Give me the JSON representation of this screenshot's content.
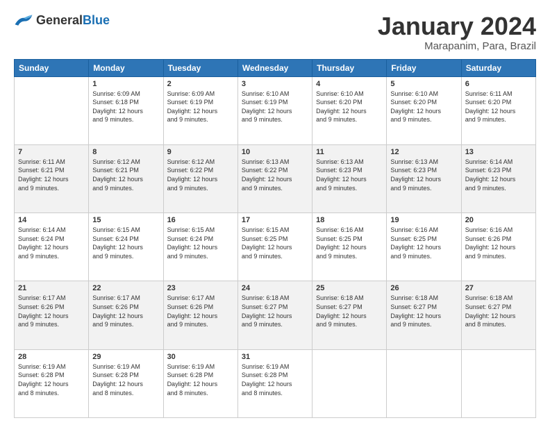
{
  "logo": {
    "general": "General",
    "blue": "Blue"
  },
  "header": {
    "title": "January 2024",
    "subtitle": "Marapanim, Para, Brazil"
  },
  "days_of_week": [
    "Sunday",
    "Monday",
    "Tuesday",
    "Wednesday",
    "Thursday",
    "Friday",
    "Saturday"
  ],
  "weeks": [
    [
      {
        "day": "",
        "info": ""
      },
      {
        "day": "1",
        "info": "Sunrise: 6:09 AM\nSunset: 6:18 PM\nDaylight: 12 hours\nand 9 minutes."
      },
      {
        "day": "2",
        "info": "Sunrise: 6:09 AM\nSunset: 6:19 PM\nDaylight: 12 hours\nand 9 minutes."
      },
      {
        "day": "3",
        "info": "Sunrise: 6:10 AM\nSunset: 6:19 PM\nDaylight: 12 hours\nand 9 minutes."
      },
      {
        "day": "4",
        "info": "Sunrise: 6:10 AM\nSunset: 6:20 PM\nDaylight: 12 hours\nand 9 minutes."
      },
      {
        "day": "5",
        "info": "Sunrise: 6:10 AM\nSunset: 6:20 PM\nDaylight: 12 hours\nand 9 minutes."
      },
      {
        "day": "6",
        "info": "Sunrise: 6:11 AM\nSunset: 6:20 PM\nDaylight: 12 hours\nand 9 minutes."
      }
    ],
    [
      {
        "day": "7",
        "info": "Sunrise: 6:11 AM\nSunset: 6:21 PM\nDaylight: 12 hours\nand 9 minutes."
      },
      {
        "day": "8",
        "info": "Sunrise: 6:12 AM\nSunset: 6:21 PM\nDaylight: 12 hours\nand 9 minutes."
      },
      {
        "day": "9",
        "info": "Sunrise: 6:12 AM\nSunset: 6:22 PM\nDaylight: 12 hours\nand 9 minutes."
      },
      {
        "day": "10",
        "info": "Sunrise: 6:13 AM\nSunset: 6:22 PM\nDaylight: 12 hours\nand 9 minutes."
      },
      {
        "day": "11",
        "info": "Sunrise: 6:13 AM\nSunset: 6:23 PM\nDaylight: 12 hours\nand 9 minutes."
      },
      {
        "day": "12",
        "info": "Sunrise: 6:13 AM\nSunset: 6:23 PM\nDaylight: 12 hours\nand 9 minutes."
      },
      {
        "day": "13",
        "info": "Sunrise: 6:14 AM\nSunset: 6:23 PM\nDaylight: 12 hours\nand 9 minutes."
      }
    ],
    [
      {
        "day": "14",
        "info": "Sunrise: 6:14 AM\nSunset: 6:24 PM\nDaylight: 12 hours\nand 9 minutes."
      },
      {
        "day": "15",
        "info": "Sunrise: 6:15 AM\nSunset: 6:24 PM\nDaylight: 12 hours\nand 9 minutes."
      },
      {
        "day": "16",
        "info": "Sunrise: 6:15 AM\nSunset: 6:24 PM\nDaylight: 12 hours\nand 9 minutes."
      },
      {
        "day": "17",
        "info": "Sunrise: 6:15 AM\nSunset: 6:25 PM\nDaylight: 12 hours\nand 9 minutes."
      },
      {
        "day": "18",
        "info": "Sunrise: 6:16 AM\nSunset: 6:25 PM\nDaylight: 12 hours\nand 9 minutes."
      },
      {
        "day": "19",
        "info": "Sunrise: 6:16 AM\nSunset: 6:25 PM\nDaylight: 12 hours\nand 9 minutes."
      },
      {
        "day": "20",
        "info": "Sunrise: 6:16 AM\nSunset: 6:26 PM\nDaylight: 12 hours\nand 9 minutes."
      }
    ],
    [
      {
        "day": "21",
        "info": "Sunrise: 6:17 AM\nSunset: 6:26 PM\nDaylight: 12 hours\nand 9 minutes."
      },
      {
        "day": "22",
        "info": "Sunrise: 6:17 AM\nSunset: 6:26 PM\nDaylight: 12 hours\nand 9 minutes."
      },
      {
        "day": "23",
        "info": "Sunrise: 6:17 AM\nSunset: 6:26 PM\nDaylight: 12 hours\nand 9 minutes."
      },
      {
        "day": "24",
        "info": "Sunrise: 6:18 AM\nSunset: 6:27 PM\nDaylight: 12 hours\nand 9 minutes."
      },
      {
        "day": "25",
        "info": "Sunrise: 6:18 AM\nSunset: 6:27 PM\nDaylight: 12 hours\nand 9 minutes."
      },
      {
        "day": "26",
        "info": "Sunrise: 6:18 AM\nSunset: 6:27 PM\nDaylight: 12 hours\nand 9 minutes."
      },
      {
        "day": "27",
        "info": "Sunrise: 6:18 AM\nSunset: 6:27 PM\nDaylight: 12 hours\nand 8 minutes."
      }
    ],
    [
      {
        "day": "28",
        "info": "Sunrise: 6:19 AM\nSunset: 6:28 PM\nDaylight: 12 hours\nand 8 minutes."
      },
      {
        "day": "29",
        "info": "Sunrise: 6:19 AM\nSunset: 6:28 PM\nDaylight: 12 hours\nand 8 minutes."
      },
      {
        "day": "30",
        "info": "Sunrise: 6:19 AM\nSunset: 6:28 PM\nDaylight: 12 hours\nand 8 minutes."
      },
      {
        "day": "31",
        "info": "Sunrise: 6:19 AM\nSunset: 6:28 PM\nDaylight: 12 hours\nand 8 minutes."
      },
      {
        "day": "",
        "info": ""
      },
      {
        "day": "",
        "info": ""
      },
      {
        "day": "",
        "info": ""
      }
    ]
  ]
}
